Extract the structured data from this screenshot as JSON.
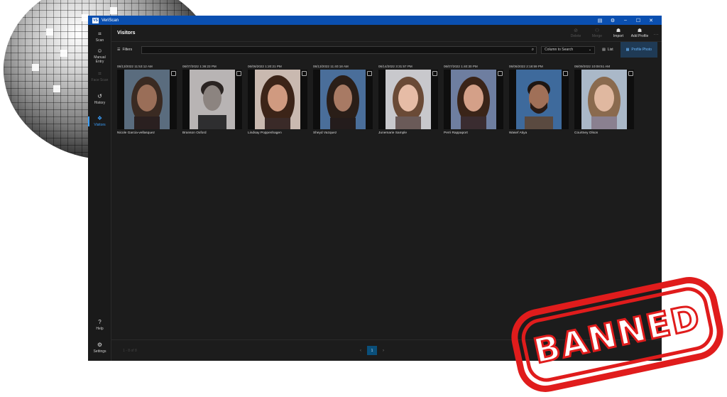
{
  "app": {
    "title": "VeriScan",
    "logo_text": "VS"
  },
  "window_controls": [
    "▤",
    "⚙",
    "–",
    "☐",
    "✕"
  ],
  "sidebar": {
    "items": [
      {
        "label": "Scan",
        "icon": "scan-icon",
        "glyph": "⌗"
      },
      {
        "label": "Manual Entry",
        "icon": "manual-entry-icon",
        "glyph": "☺"
      },
      {
        "label": "Face Scan",
        "icon": "face-scan-icon",
        "glyph": "⌗"
      },
      {
        "label": "History",
        "icon": "history-icon",
        "glyph": "↺"
      },
      {
        "label": "Visitors",
        "icon": "visitors-icon",
        "glyph": "❖"
      },
      {
        "label": "Help",
        "icon": "help-icon",
        "glyph": "?"
      },
      {
        "label": "Settings",
        "icon": "settings-icon",
        "glyph": "⚙"
      }
    ]
  },
  "header": {
    "title": "Visitors",
    "actions": [
      {
        "label": "Delete",
        "glyph": "⊘"
      },
      {
        "label": "Merge",
        "glyph": "⚇"
      },
      {
        "label": "Import",
        "glyph": "☗"
      },
      {
        "label": "Add Profile",
        "glyph": "☗"
      }
    ],
    "more": "…"
  },
  "toolbar": {
    "filters_label": "Filters",
    "search_value": "",
    "column_select": "Column to Search",
    "list_label": "List",
    "profile_photo_label": "Profile Photo"
  },
  "visitors": [
    {
      "date": "06/13/2022 11:53:12 AM",
      "name": "Nicole Garcia-vellasquez"
    },
    {
      "date": "06/07/2022 1:36:23 PM",
      "name": "Branson Oxford"
    },
    {
      "date": "06/06/2022 1:20:21 PM",
      "name": "Lindsay Poppenhagen"
    },
    {
      "date": "06/13/2022 11:40:18 AM",
      "name": "Sheyd Vazquez"
    },
    {
      "date": "06/14/2022 3:31:57 PM",
      "name": "Junemarie Sample"
    },
    {
      "date": "06/07/2022 1:40:30 PM",
      "name": "Perri Rappaport"
    },
    {
      "date": "06/06/2022 2:18:59 PM",
      "name": "Wasef Atiya"
    },
    {
      "date": "06/09/2022 10:08:51 AM",
      "name": "Courtney Olson"
    }
  ],
  "footer": {
    "range": "1 - 8 of 8",
    "prev": "‹",
    "page": "1",
    "next": "›"
  },
  "stamp": {
    "text": "BANNED"
  },
  "colors": {
    "accent": "#3aa0ff",
    "titlebar": "#0a4fb0",
    "stamp": "#e01c1c"
  }
}
